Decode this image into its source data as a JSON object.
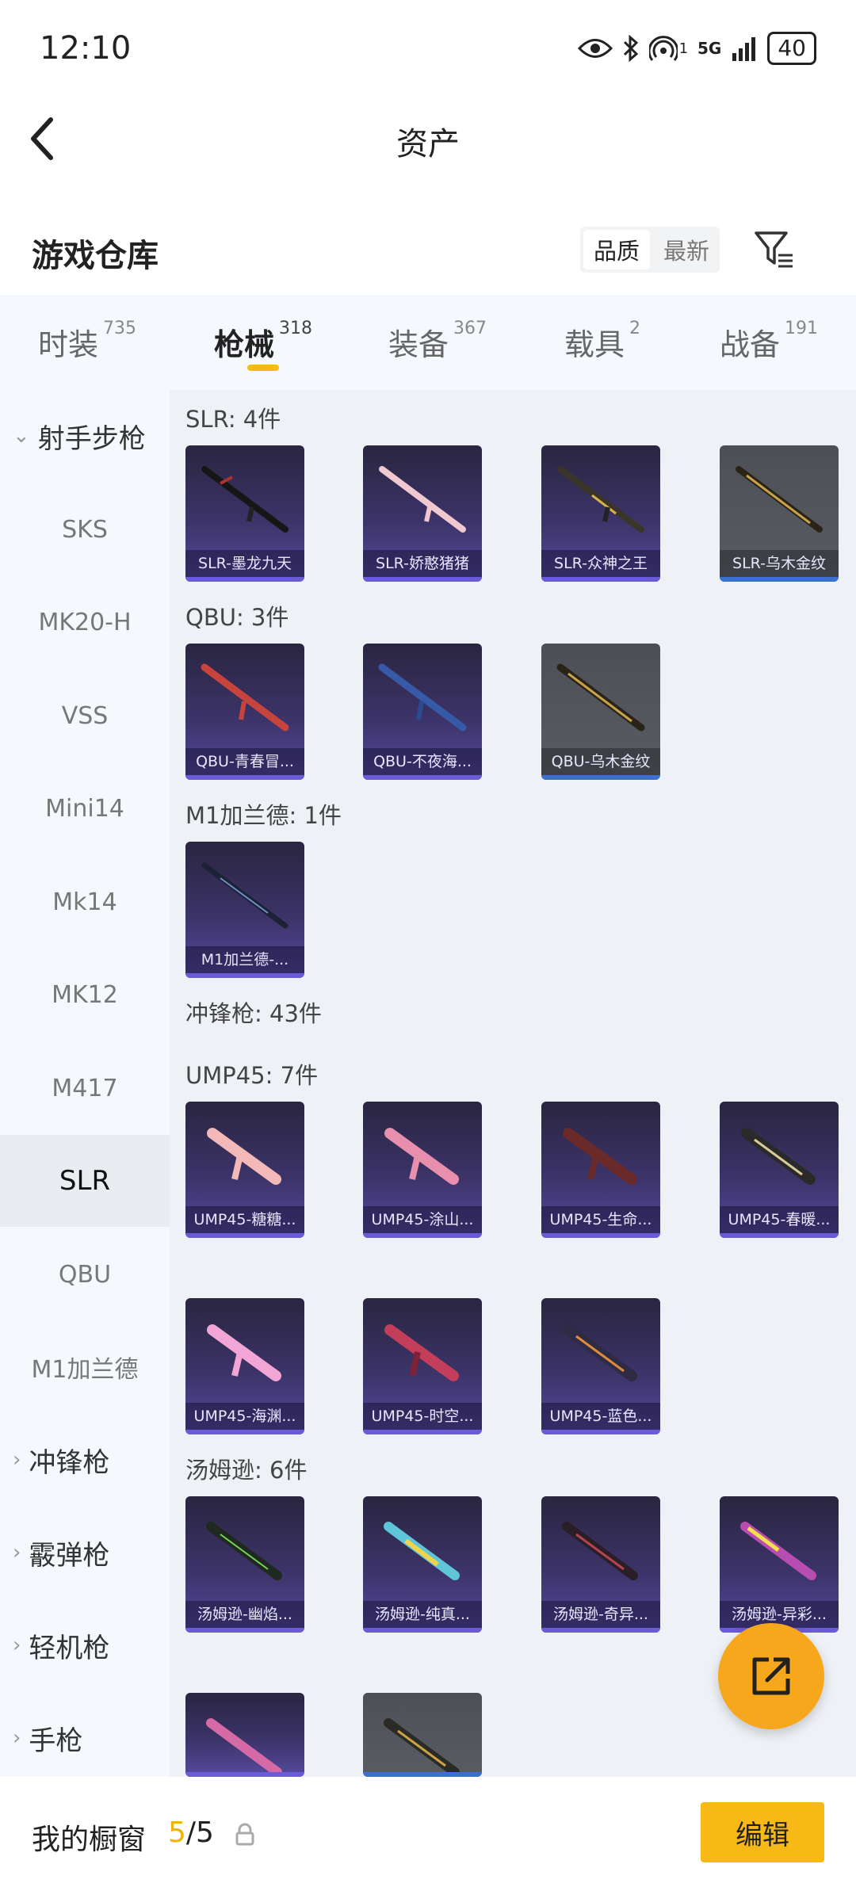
{
  "status": {
    "time": "12:10",
    "signal_label": "5G",
    "sim": "1",
    "battery": "40"
  },
  "header": {
    "title": "资产"
  },
  "repo": {
    "title": "游戏仓库",
    "sort_quality": "品质",
    "sort_latest": "最新"
  },
  "tabs": [
    {
      "label": "时装",
      "count": "735"
    },
    {
      "label": "枪械",
      "count": "318"
    },
    {
      "label": "装备",
      "count": "367"
    },
    {
      "label": "载具",
      "count": "2"
    },
    {
      "label": "战备",
      "count": "191"
    }
  ],
  "sidebar": {
    "group_sniper": "射手步枪",
    "items": [
      "SKS",
      "MK20-H",
      "VSS",
      "Mini14",
      "Mk14",
      "MK12",
      "M417",
      "SLR",
      "QBU",
      "M1加兰德"
    ],
    "groups": [
      "冲锋枪",
      "霰弹枪",
      "轻机枪",
      "手枪"
    ]
  },
  "sections": {
    "slr": "SLR: 4件",
    "qbu": "QBU: 3件",
    "m1": "M1加兰德: 1件",
    "smg": "冲锋枪: 43件",
    "ump": "UMP45: 7件",
    "tommy": "汤姆逊: 6件"
  },
  "cards": {
    "slr": [
      "SLR-墨龙九天",
      "SLR-娇憨猪猪",
      "SLR-众神之王",
      "SLR-乌木金纹"
    ],
    "qbu": [
      "QBU-青春冒...",
      "QBU-不夜海...",
      "QBU-乌木金纹"
    ],
    "m1": [
      "M1加兰德-..."
    ],
    "ump": [
      "UMP45-糖糖...",
      "UMP45-涂山...",
      "UMP45-生命...",
      "UMP45-春暖...",
      "UMP45-海渊...",
      "UMP45-时空...",
      "UMP45-蓝色..."
    ],
    "tommy": [
      "汤姆逊-幽焰...",
      "汤姆逊-纯真...",
      "汤姆逊-奇异...",
      "汤姆逊-异彩..."
    ]
  },
  "bottom": {
    "label": "我的橱窗",
    "current": "5",
    "total": "/5",
    "edit": "编辑"
  },
  "colors": {
    "accent": "#f7b916",
    "fab": "#f7a71b",
    "card_purple": "#3c3368"
  }
}
